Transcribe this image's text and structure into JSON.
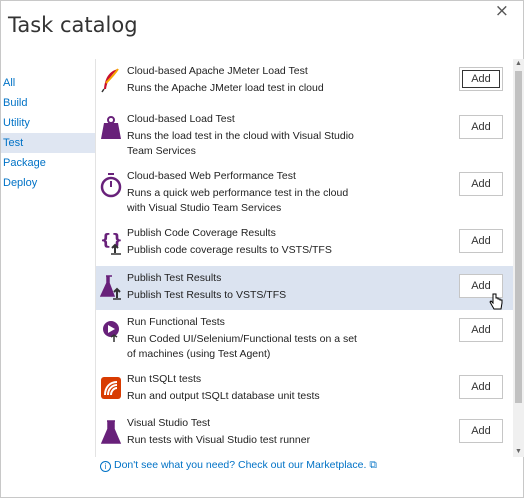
{
  "dialog": {
    "title": "Task catalog",
    "close_glyph": "×"
  },
  "categories": [
    {
      "label": "All",
      "selected": false
    },
    {
      "label": "Build",
      "selected": false
    },
    {
      "label": "Utility",
      "selected": false
    },
    {
      "label": "Test",
      "selected": true
    },
    {
      "label": "Package",
      "selected": false
    },
    {
      "label": "Deploy",
      "selected": false
    }
  ],
  "tasks": [
    {
      "name": "Cloud-based Apache JMeter Load Test",
      "description": "Runs the Apache JMeter load test in cloud",
      "icon": "jmeter-feather-icon",
      "add_label": "Add"
    },
    {
      "name": "Cloud-based Load Test",
      "description": "Runs the load test in the cloud with Visual Studio Team Services",
      "icon": "weight-icon",
      "add_label": "Add"
    },
    {
      "name": "Cloud-based Web Performance Test",
      "description": "Runs a quick web performance test in the cloud with Visual Studio Team Services",
      "icon": "stopwatch-icon",
      "add_label": "Add"
    },
    {
      "name": "Publish Code Coverage Results",
      "description": "Publish code coverage results to VSTS/TFS",
      "icon": "code-coverage-upload-icon",
      "add_label": "Add"
    },
    {
      "name": "Publish Test Results",
      "description": "Publish Test Results to VSTS/TFS",
      "icon": "flask-upload-icon",
      "add_label": "Add"
    },
    {
      "name": "Run Functional Tests",
      "description": "Run Coded UI/Selenium/Functional tests on a set of machines (using Test Agent)",
      "icon": "functional-test-icon",
      "add_label": "Add"
    },
    {
      "name": "Run tSQLt tests",
      "description": "Run and output tSQLt database unit tests",
      "icon": "tsqlt-icon",
      "add_label": "Add"
    },
    {
      "name": "Visual Studio Test",
      "description": "Run tests with Visual Studio test runner",
      "icon": "flask-icon",
      "add_label": "Add"
    }
  ],
  "footer": {
    "info_glyph": "i",
    "text": "Don't see what you need? Check out our Marketplace.",
    "external_glyph": "⧉"
  },
  "colors": {
    "accent": "#0072c6",
    "icon_purple": "#68217a",
    "tsqlt_red": "#d83b01",
    "hover_row": "#dbe3f0"
  }
}
